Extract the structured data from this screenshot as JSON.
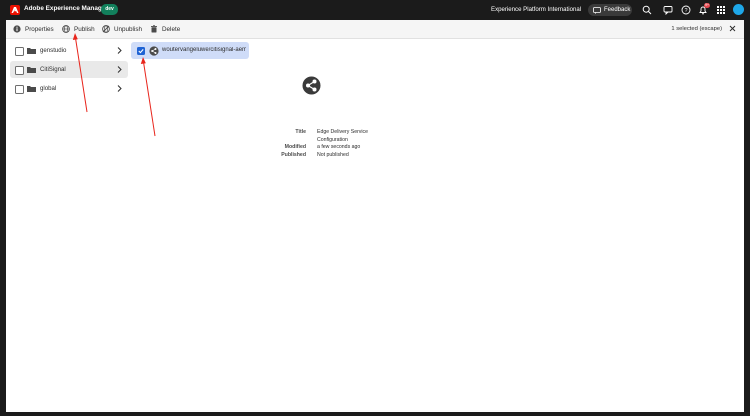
{
  "shell": {
    "app_title": "Adobe Experience Manager",
    "environment": "dev",
    "org_name": "Experience Platform International",
    "feedback_label": "Feedback",
    "notification_count": "9+",
    "brand_color": "#eb1000"
  },
  "actionbar": {
    "properties_label": "Properties",
    "publish_label": "Publish",
    "unpublish_label": "Unpublish",
    "delete_label": "Delete",
    "selection_info": "1 selected (escape)"
  },
  "column1": {
    "items": [
      {
        "label": "genstudio"
      },
      {
        "label": "CitiSignal"
      },
      {
        "label": "global"
      }
    ]
  },
  "column2": {
    "items": [
      {
        "label": "woutervangeluwe/citisignal-aem-…"
      }
    ]
  },
  "preview": {
    "title_key": "Title",
    "title_value": "Edge Delivery Service Configuration",
    "modified_key": "Modified",
    "modified_value": "a few seconds ago",
    "published_key": "Published",
    "published_value": "Not published"
  },
  "annotation_color": "#e8251c"
}
